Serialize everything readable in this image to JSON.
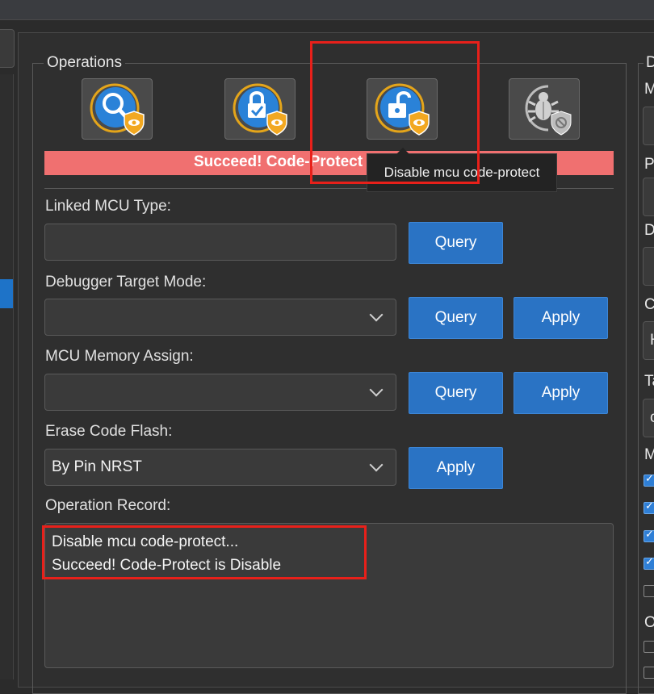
{
  "operations": {
    "legend": "Operations",
    "buttons": [
      {
        "icon": "query-protect-icon"
      },
      {
        "icon": "enable-protect-icon"
      },
      {
        "icon": "disable-protect-icon"
      },
      {
        "icon": "disable-debug-icon"
      }
    ],
    "status": "Succeed! Code-Protect is Disable",
    "tooltip": "Disable mcu code-protect"
  },
  "fields": {
    "linked_mcu": {
      "label": "Linked MCU Type:",
      "value": "",
      "query": "Query"
    },
    "debugger_mode": {
      "label": "Debugger Target Mode:",
      "value": "",
      "query": "Query",
      "apply": "Apply"
    },
    "memory_assign": {
      "label": "MCU Memory Assign:",
      "value": "",
      "query": "Query",
      "apply": "Apply"
    },
    "erase_flash": {
      "label": "Erase Code Flash:",
      "value": "By Pin NRST",
      "apply": "Apply"
    }
  },
  "record": {
    "label": "Operation Record:",
    "lines": [
      "Disable mcu code-protect...",
      "Succeed! Code-Protect is Disable"
    ]
  },
  "right_panel": {
    "legend": "D",
    "labels": [
      "M",
      "P",
      "D",
      "C",
      "Ta",
      "M",
      "O"
    ],
    "box_texts": [
      "H",
      "c"
    ]
  },
  "colors": {
    "accent": "#2a73c4",
    "status_bg": "#f07070",
    "highlight": "#e8201a"
  }
}
